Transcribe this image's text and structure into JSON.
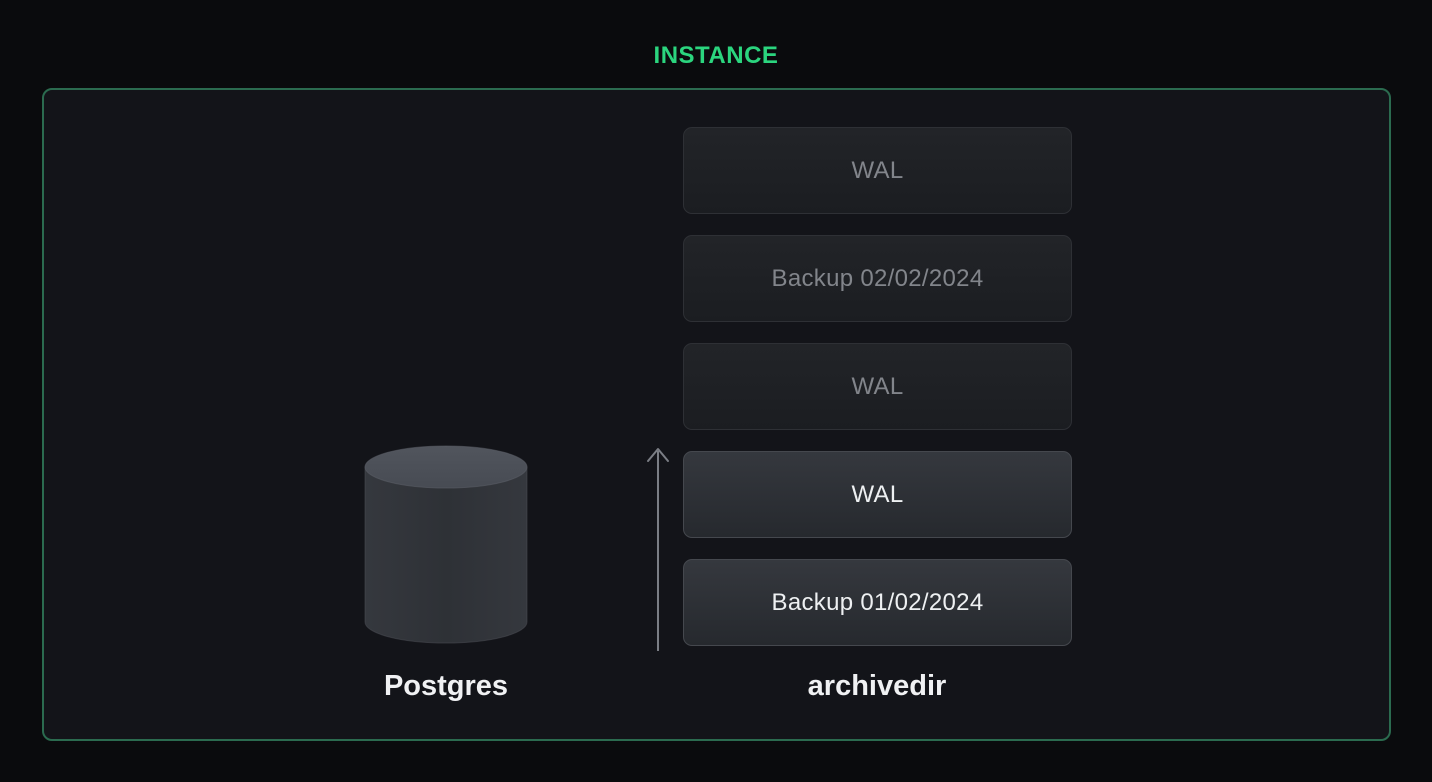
{
  "title": "INSTANCE",
  "colors": {
    "accent_green": "#2bd57e",
    "panel_border_green": "#2b6b4f",
    "canvas_bg": "#0a0b0d",
    "panel_bg": "#131419",
    "active_text": "#eef0f2",
    "dim_text": "#82858b"
  },
  "database": {
    "icon": "database-cylinder-icon",
    "label": "Postgres"
  },
  "archive": {
    "label": "archivedir",
    "arrow_icon": "arrow-up-icon",
    "items": [
      {
        "label": "WAL",
        "state": "dim"
      },
      {
        "label": "Backup 02/02/2024",
        "state": "dim"
      },
      {
        "label": "WAL",
        "state": "dim"
      },
      {
        "label": "WAL",
        "state": "active"
      },
      {
        "label": "Backup 01/02/2024",
        "state": "active"
      }
    ]
  }
}
